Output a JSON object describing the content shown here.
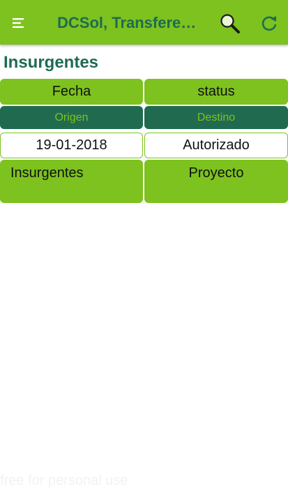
{
  "appbar": {
    "title": "DCSol, Transferencias",
    "menu_icon": "menu-icon",
    "search_icon": "search-icon",
    "refresh_icon": "refresh-icon",
    "color": "#7dc21e",
    "title_color": "#1e6b52"
  },
  "section": {
    "title": "Insurgentes"
  },
  "headers": {
    "fecha": "Fecha",
    "status": "status",
    "origen": "Origen",
    "destino": "Destino"
  },
  "record": {
    "fecha": "19-01-2018",
    "status": "Autorizado",
    "origen": "Insurgentes",
    "destino": "Proyecto"
  },
  "watermark": "free for personal use"
}
